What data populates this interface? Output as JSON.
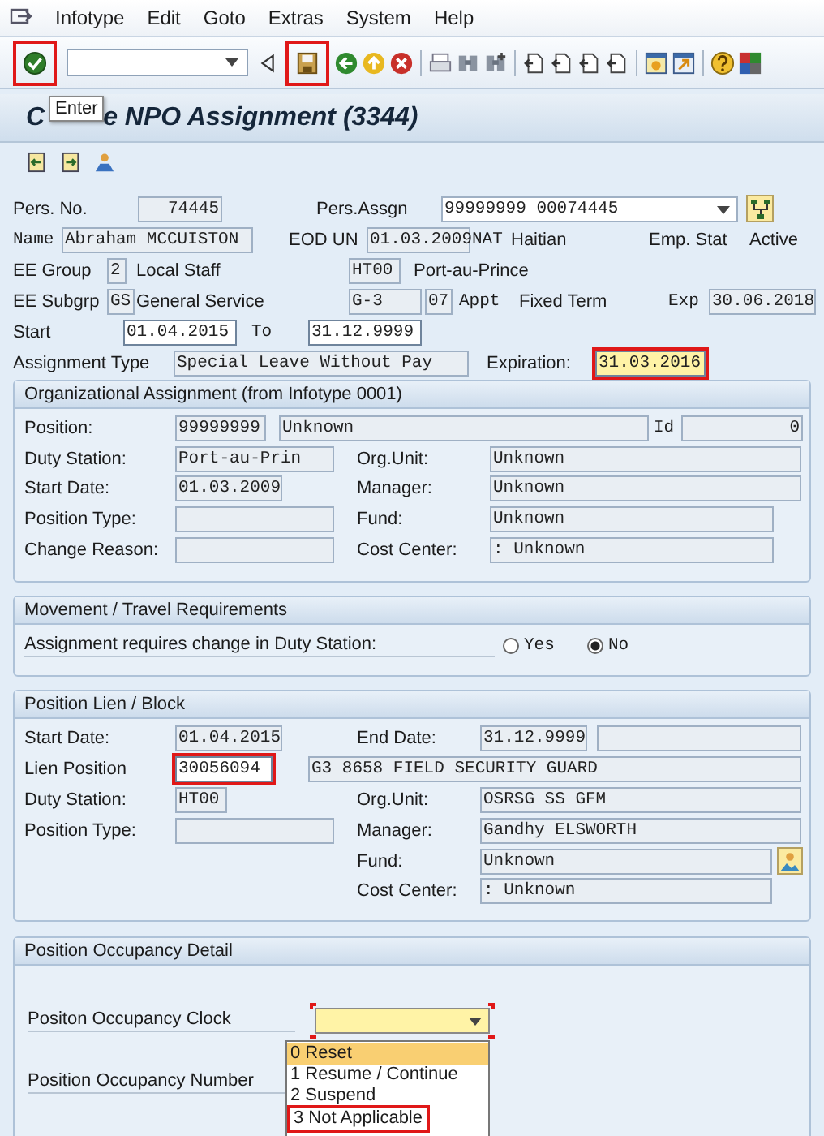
{
  "menu": [
    "Infotype",
    "Edit",
    "Goto",
    "Extras",
    "System",
    "Help"
  ],
  "toolbar": [
    {
      "kind": "enter",
      "highlighted": true
    },
    {
      "kind": "command-field",
      "highlighted": false
    },
    {
      "kind": "collapse",
      "highlighted": false
    },
    {
      "kind": "save",
      "highlighted": true
    },
    {
      "kind": "back",
      "highlighted": false
    },
    {
      "kind": "exit",
      "highlighted": false
    },
    {
      "kind": "cancel",
      "highlighted": false
    },
    {
      "kind": "separator",
      "highlighted": false
    },
    {
      "kind": "print",
      "highlighted": false
    },
    {
      "kind": "find",
      "highlighted": false
    },
    {
      "kind": "find-next",
      "highlighted": false
    },
    {
      "kind": "separator",
      "highlighted": false
    },
    {
      "kind": "first-page",
      "highlighted": false
    },
    {
      "kind": "previous-page",
      "highlighted": false
    },
    {
      "kind": "next-page",
      "highlighted": false
    },
    {
      "kind": "last-page",
      "highlighted": false
    },
    {
      "kind": "separator",
      "highlighted": false
    },
    {
      "kind": "new-session",
      "highlighted": false
    },
    {
      "kind": "shortcut",
      "highlighted": false
    },
    {
      "kind": "separator",
      "highlighted": false
    },
    {
      "kind": "help",
      "highlighted": false
    },
    {
      "kind": "layout",
      "highlighted": false
    }
  ],
  "tooltip": "Enter",
  "title_parts": [
    "C",
    "e NPO Assignment (3344)"
  ],
  "app_toolbar": [
    {
      "kind": "previous-record"
    },
    {
      "kind": "next-record"
    },
    {
      "kind": "org-structure"
    }
  ],
  "header": {
    "lines": [
      {
        "items": [
          {
            "kind": "label",
            "text": "Pers. No."
          },
          {
            "kind": "numeric-field",
            "value": "74445"
          },
          {
            "kind": "label",
            "text": "Pers.Assgn"
          },
          {
            "kind": "dropdown",
            "value": "99999999 00074445"
          },
          {
            "kind": "hierarchy-button"
          }
        ]
      },
      {
        "items": [
          {
            "kind": "mono-label",
            "text": "Name"
          },
          {
            "kind": "field",
            "value": "Abraham MCCUISTON"
          },
          {
            "kind": "label",
            "text": "EOD UN"
          },
          {
            "kind": "field",
            "value": "01.03.2009"
          },
          {
            "kind": "mono-label",
            "text": "NAT"
          },
          {
            "kind": "text",
            "text": "Haitian"
          },
          {
            "kind": "label",
            "text": "Emp. Stat"
          },
          {
            "kind": "text",
            "text": "Active"
          }
        ]
      },
      {
        "items": [
          {
            "kind": "label",
            "text": "EE Group"
          },
          {
            "kind": "field",
            "value": "2"
          },
          {
            "kind": "text",
            "text": "Local Staff"
          },
          {
            "kind": "field",
            "value": "HT00"
          },
          {
            "kind": "text",
            "text": "Port-au-Prince"
          }
        ]
      },
      {
        "items": [
          {
            "kind": "label",
            "text": "EE Subgrp"
          },
          {
            "kind": "field",
            "value": "GS"
          },
          {
            "kind": "text",
            "text": "General Service"
          },
          {
            "kind": "field",
            "value": "G-3"
          },
          {
            "kind": "field",
            "value": "07"
          },
          {
            "kind": "mono-label",
            "text": "Appt"
          },
          {
            "kind": "text",
            "text": "Fixed Term"
          },
          {
            "kind": "mono-label",
            "text": "Exp"
          },
          {
            "kind": "field",
            "value": "30.06.2018"
          }
        ]
      },
      {
        "items": [
          {
            "kind": "label",
            "text": "Start"
          },
          {
            "kind": "field",
            "value": "01.04.2015",
            "editable": true
          },
          {
            "kind": "mono-label",
            "text": "To"
          },
          {
            "kind": "field",
            "value": "31.12.9999",
            "editable": true
          }
        ]
      },
      {
        "items": [
          {
            "kind": "label",
            "text": "Assignment Type"
          },
          {
            "kind": "field",
            "value": "Special Leave Without Pay"
          },
          {
            "kind": "label",
            "text": "Expiration:"
          },
          {
            "kind": "field",
            "value": "31.03.2016",
            "editable": true,
            "focused": true,
            "highlighted": true
          }
        ]
      }
    ]
  },
  "organizational_assignment": {
    "title": "Organizational Assignment (from Infotype 0001)",
    "lines": [
      {
        "items": [
          {
            "kind": "label",
            "text": "Position:"
          },
          {
            "kind": "field",
            "value": "99999999"
          },
          {
            "kind": "field",
            "value": "Unknown"
          },
          {
            "kind": "mono-label",
            "text": "Id"
          },
          {
            "kind": "numeric-field",
            "value": "0"
          }
        ]
      },
      {
        "items": [
          {
            "kind": "label",
            "text": "Duty Station:"
          },
          {
            "kind": "field",
            "value": "Port-au-Prin"
          },
          {
            "kind": "label",
            "text": "Org.Unit:"
          },
          {
            "kind": "field",
            "value": "Unknown"
          }
        ]
      },
      {
        "items": [
          {
            "kind": "label",
            "text": "Start Date:"
          },
          {
            "kind": "field",
            "value": "01.03.2009"
          },
          {
            "kind": "label",
            "text": "Manager:"
          },
          {
            "kind": "field",
            "value": "Unknown"
          }
        ]
      },
      {
        "items": [
          {
            "kind": "label",
            "text": "Position Type:"
          },
          {
            "kind": "field"
          },
          {
            "kind": "label",
            "text": "Fund:"
          },
          {
            "kind": "field",
            "value": "Unknown"
          }
        ]
      },
      {
        "items": [
          {
            "kind": "label",
            "text": "Change Reason:"
          },
          {
            "kind": "field"
          },
          {
            "kind": "label",
            "text": "Cost Center:"
          },
          {
            "kind": "field",
            "value": ": Unknown"
          }
        ]
      }
    ]
  },
  "movement": {
    "title": "Movement / Travel Requirements",
    "lines": [
      {
        "items": [
          {
            "kind": "underlined-label",
            "text": "Assignment requires change in Duty Station:"
          },
          {
            "kind": "radio",
            "text": "Yes",
            "selected": false
          },
          {
            "kind": "radio",
            "text": "No",
            "selected": true
          }
        ]
      }
    ]
  },
  "position_lien": {
    "title": "Position Lien / Block",
    "lines": [
      {
        "items": [
          {
            "kind": "label",
            "text": "Start Date:"
          },
          {
            "kind": "field",
            "value": "01.04.2015"
          },
          {
            "kind": "label",
            "text": "End Date:"
          },
          {
            "kind": "field",
            "value": "31.12.9999"
          },
          {
            "kind": "field"
          }
        ]
      },
      {
        "items": [
          {
            "kind": "label",
            "text": "Lien Position"
          },
          {
            "kind": "field",
            "value": "30056094",
            "editable": true,
            "highlighted": true
          },
          {
            "kind": "field",
            "value": "G3 8658 FIELD SECURITY GUARD"
          }
        ]
      },
      {
        "items": [
          {
            "kind": "label",
            "text": "Duty Station:"
          },
          {
            "kind": "field",
            "value": "HT00"
          },
          {
            "kind": "label",
            "text": "Org.Unit:"
          },
          {
            "kind": "field",
            "value": "OSRSG SS GFM"
          }
        ]
      },
      {
        "items": [
          {
            "kind": "label",
            "text": "Position Type:"
          },
          {
            "kind": "field"
          },
          {
            "kind": "label",
            "text": "Manager:"
          },
          {
            "kind": "field",
            "value": "Gandhy ELSWORTH"
          }
        ]
      },
      {
        "items": [
          {
            "kind": "label",
            "text": "Fund:"
          },
          {
            "kind": "field",
            "value": "Unknown"
          },
          {
            "kind": "picture-button"
          }
        ]
      },
      {
        "items": [
          {
            "kind": "label",
            "text": "Cost Center:"
          },
          {
            "kind": "field",
            "value": ": Unknown"
          }
        ]
      }
    ]
  },
  "position_occupancy": {
    "title": "Position Occupancy Detail",
    "clock_label": "Positon Occupancy Clock",
    "clock_dropdown": {
      "focused": true,
      "highlighted": true
    },
    "number_label": "Position Occupancy Number",
    "options": [
      {
        "text": "0 Reset",
        "selected": true,
        "highlighted": false
      },
      {
        "text": "1 Resume / Continue",
        "selected": false,
        "highlighted": false
      },
      {
        "text": "2 Suspend",
        "selected": false,
        "highlighted": false
      },
      {
        "text": "3 Not Applicable",
        "selected": false,
        "highlighted": true
      }
    ]
  }
}
